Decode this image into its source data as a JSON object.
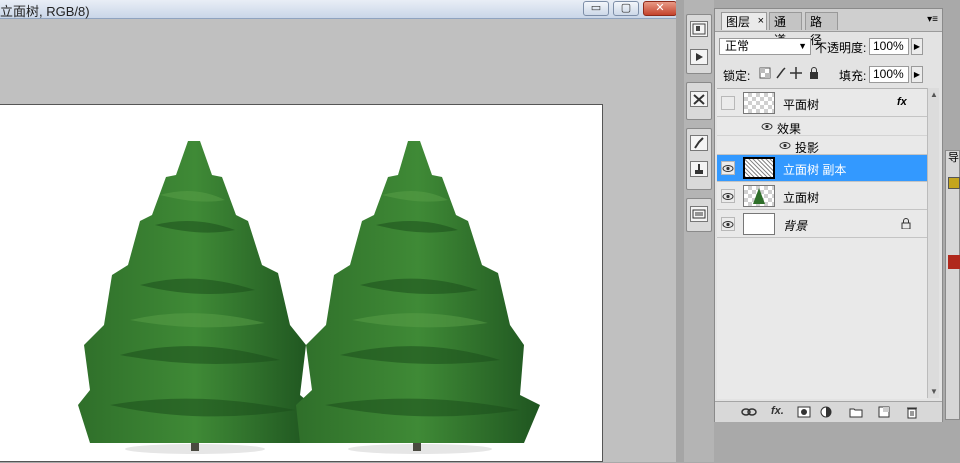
{
  "document": {
    "title": "立面树, RGB/8)",
    "buttons": {
      "minimize": "▭",
      "maximize": "▢",
      "close": "✕"
    }
  },
  "layers_panel": {
    "tabs": [
      {
        "label": "图层",
        "active": true
      },
      {
        "label": "通道",
        "active": false
      },
      {
        "label": "路径",
        "active": false
      }
    ],
    "tab_close": "×",
    "blend_mode": "正常",
    "opacity_label": "不透明度:",
    "opacity_value": "100%",
    "lock_label": "锁定:",
    "fill_label": "填充:",
    "fill_value": "100%",
    "layers": [
      {
        "name": "平面树",
        "visible": false,
        "thumb": "transparent",
        "fx": "fx",
        "selected": false
      },
      {
        "name": "效果",
        "type": "effects-group"
      },
      {
        "name": "投影",
        "type": "effect"
      },
      {
        "name": "立面树 副本",
        "visible": true,
        "thumb": "pattern",
        "selected": true
      },
      {
        "name": "立面树",
        "visible": true,
        "thumb": "tree",
        "selected": false
      },
      {
        "name": "背景",
        "visible": true,
        "thumb": "white",
        "locked": true,
        "selected": false
      }
    ],
    "toolbar_icons": [
      "link-icon",
      "fx-icon",
      "mask-icon",
      "adjustment-icon",
      "group-icon",
      "new-layer-icon",
      "trash-icon"
    ],
    "fx_toolbar_label": "fx."
  },
  "right_panel": {
    "tab_text": "导",
    "colors": {
      "swatch": "#c4a51e",
      "accent": "#b0281c"
    }
  },
  "colors": {
    "selection": "#3399ff",
    "tree_dark": "#1f5a1f",
    "tree_light": "#4a8f3a"
  }
}
